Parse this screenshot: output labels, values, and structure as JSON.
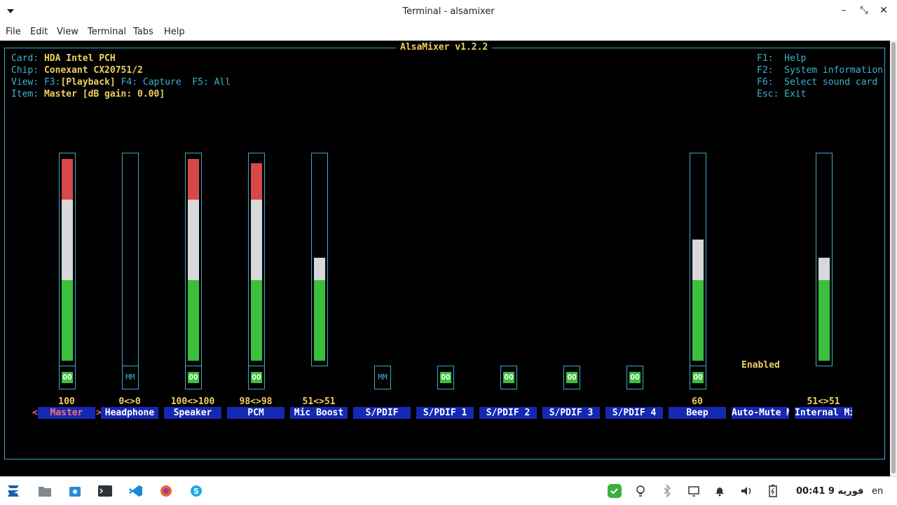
{
  "window": {
    "title": "Terminal - alsamixer"
  },
  "menu": [
    "File",
    "Edit",
    "View",
    "Terminal",
    "Tabs",
    "Help"
  ],
  "mixer": {
    "header": "AlsaMixer v1.2.2",
    "card_key": "Card:",
    "card_val": "HDA Intel PCH",
    "chip_key": "Chip:",
    "chip_val": "Conexant CX20751/2",
    "view_key": "View:",
    "view_f3": "F3:",
    "view_playback": "[Playback]",
    "view_rest": "F4: Capture  F5: All",
    "item_key": "Item:",
    "item_val": "Master [dB gain: 0.00]",
    "help": [
      "F1:  Help",
      "F2:  System information",
      "F6:  Select sound card",
      "Esc: Exit"
    ],
    "enabled_text": "Enabled",
    "channels": [
      {
        "name": "Master",
        "value": "100",
        "level": 1.0,
        "mute": "OO",
        "selected": true
      },
      {
        "name": "Headphone",
        "value": "0<>0",
        "level": 0.0,
        "mute": "MM"
      },
      {
        "name": "Speaker",
        "value": "100<>100",
        "level": 1.0,
        "mute": "OO"
      },
      {
        "name": "PCM",
        "value": "98<>98",
        "level": 0.98,
        "mute": "OO"
      },
      {
        "name": "Mic Boost",
        "value": "51<>51",
        "level": 0.51
      },
      {
        "name": "S/PDIF",
        "mute": "MM"
      },
      {
        "name": "S/PDIF 1",
        "mute": "OO"
      },
      {
        "name": "S/PDIF 2",
        "mute": "OO"
      },
      {
        "name": "S/PDIF 3",
        "mute": "OO"
      },
      {
        "name": "S/PDIF 4",
        "mute": "OO"
      },
      {
        "name": "Beep",
        "value": "60",
        "level": 0.6,
        "mute": "OO"
      },
      {
        "name": "Auto-Mute M"
      },
      {
        "name": "Internal Mi",
        "value": "51<>51",
        "level": 0.51
      }
    ]
  },
  "taskbar": {
    "clock": "00:41 9 فوريه",
    "lang": "en"
  },
  "colors": {
    "green": "#3cbf3c",
    "white": "#d8d8d8",
    "red": "#d84848",
    "cyan": "#3fa9c9",
    "label_bg": "#1428b4"
  }
}
